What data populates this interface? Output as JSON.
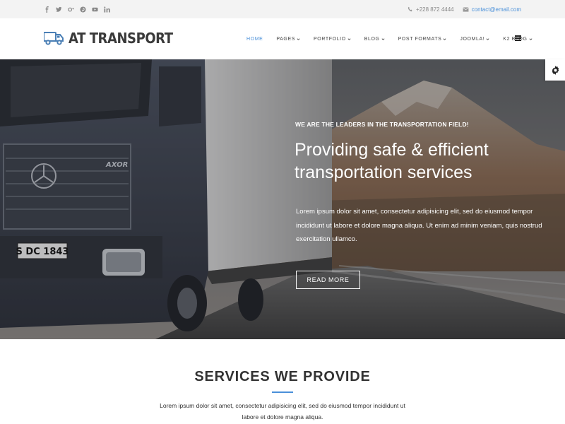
{
  "topbar": {
    "social_icons": [
      "facebook-icon",
      "twitter-icon",
      "google-plus-icon",
      "pinterest-icon",
      "youtube-icon",
      "linkedin-icon"
    ],
    "phone": "+228 872 4444",
    "email": "contact@email.com"
  },
  "header": {
    "logo_text": "AT TRANSPORT",
    "nav": [
      {
        "label": "HOME",
        "has_dropdown": false,
        "active": true
      },
      {
        "label": "PAGES",
        "has_dropdown": true
      },
      {
        "label": "PORTFOLIO",
        "has_dropdown": true
      },
      {
        "label": "BLOG",
        "has_dropdown": true
      },
      {
        "label": "POST FORMATS",
        "has_dropdown": true
      },
      {
        "label": "JOOMLA!",
        "has_dropdown": true
      },
      {
        "label": "K2 BLOG",
        "has_dropdown": true
      }
    ]
  },
  "hero": {
    "kicker": "WE ARE THE LEADERS IN THE TRANSPORTATION FIELD!",
    "title": "Providing safe & efficient transportation services",
    "text": "Lorem ipsum dolor sit amet, consectetur adipisicing elit, sed do eiusmod tempor incididunt ut labore et dolore magna aliqua. Ut enim ad minim veniam, quis nostrud exercitation ullamco.",
    "button": "READ MORE",
    "truck_badge": "AXOR",
    "plate": "S DC 1843"
  },
  "services": {
    "title": "SERVICES WE PROVIDE",
    "text": "Lorem ipsum dolor sit amet, consectetur adipisicing elit, sed do eiusmod tempor incididunt ut labore et dolore magna aliqua."
  },
  "colors": {
    "accent": "#4a90d9",
    "topbar_bg": "#f3f3f3",
    "text_dark": "#333333"
  }
}
